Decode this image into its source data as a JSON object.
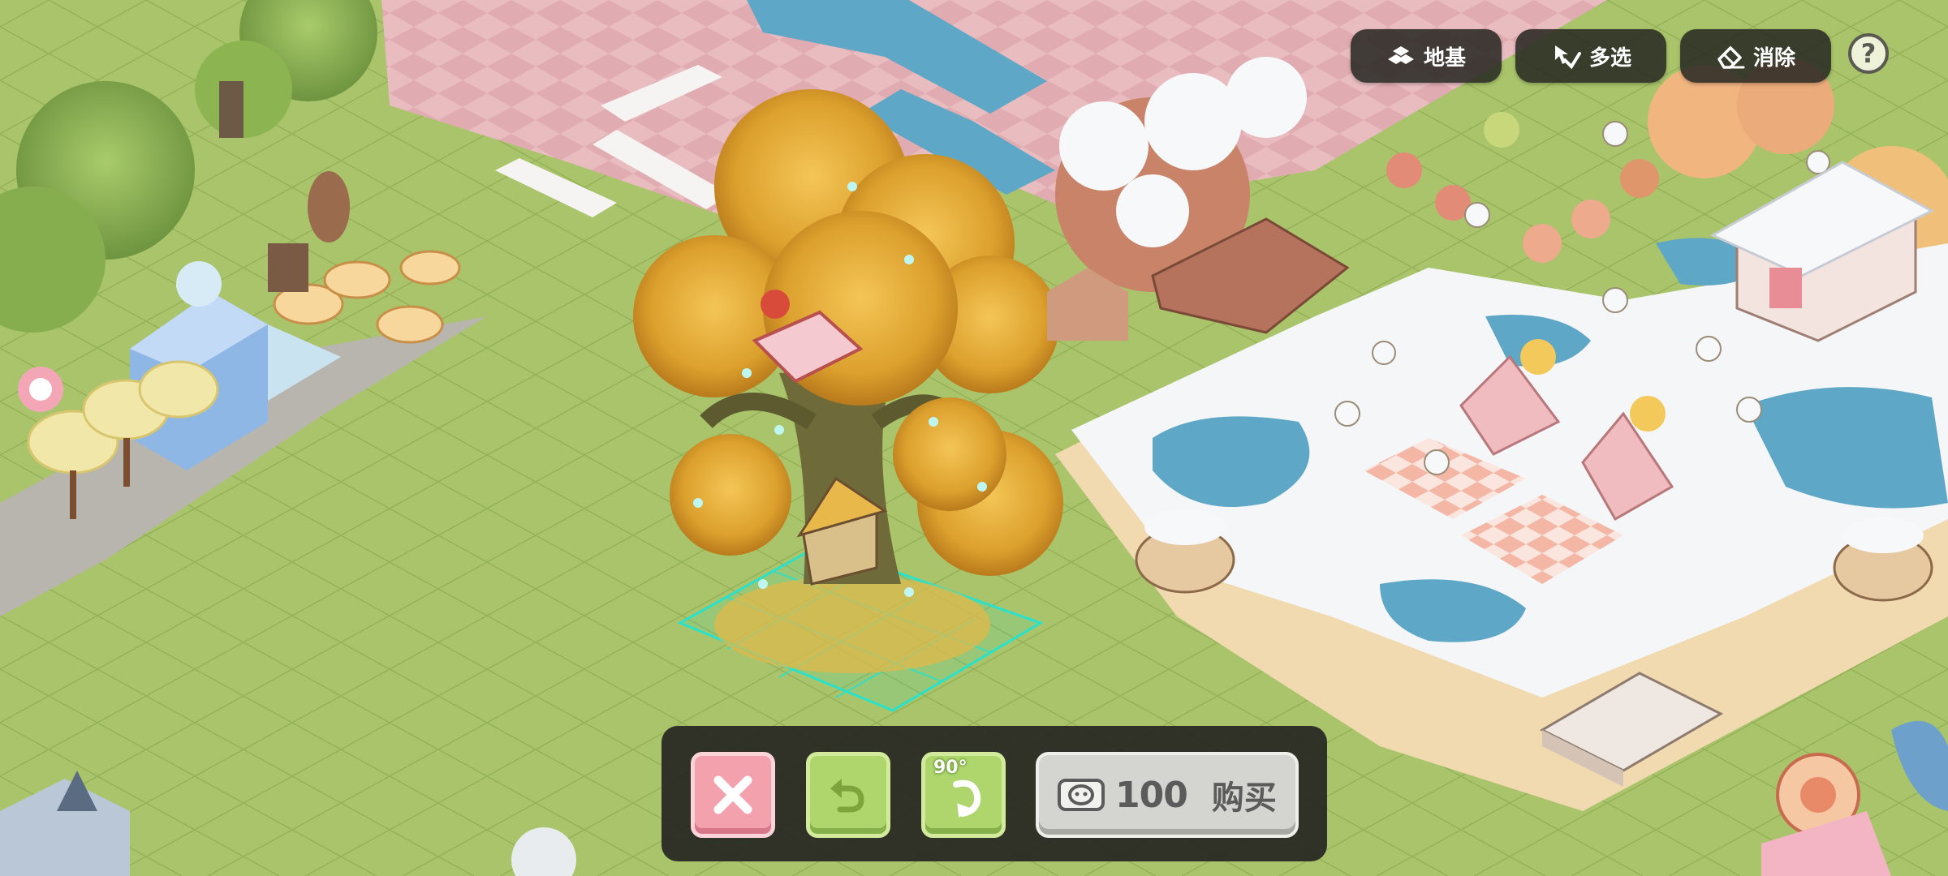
{
  "toolbar": {
    "foundation_label": "地基",
    "multiselect_label": "多选",
    "erase_label": "消除",
    "help_label": "?"
  },
  "placement_bar": {
    "rotate_label": "90°",
    "buy_price": "100",
    "buy_label": "购买"
  },
  "colors": {
    "grass": "#a9c46a",
    "pink_plaza": "#e8b9bd",
    "snow": "#f4f6f8",
    "water": "#5fa7c6",
    "sand": "#f1d9b0",
    "autumn_leaves": "#e2a930",
    "placement_outline": "#28e2cc",
    "cancel_pink": "#f3a2ad",
    "confirm_green": "#aed66c",
    "buy_gray": "#d4d4d0"
  },
  "icons": {
    "foundation": "foundation-icon",
    "multiselect": "multiselect-icon",
    "erase": "eraser-icon",
    "help": "question-icon",
    "cancel": "close-icon",
    "undo": "undo-icon",
    "rotate": "rotate-icon",
    "currency": "coin-icon"
  }
}
